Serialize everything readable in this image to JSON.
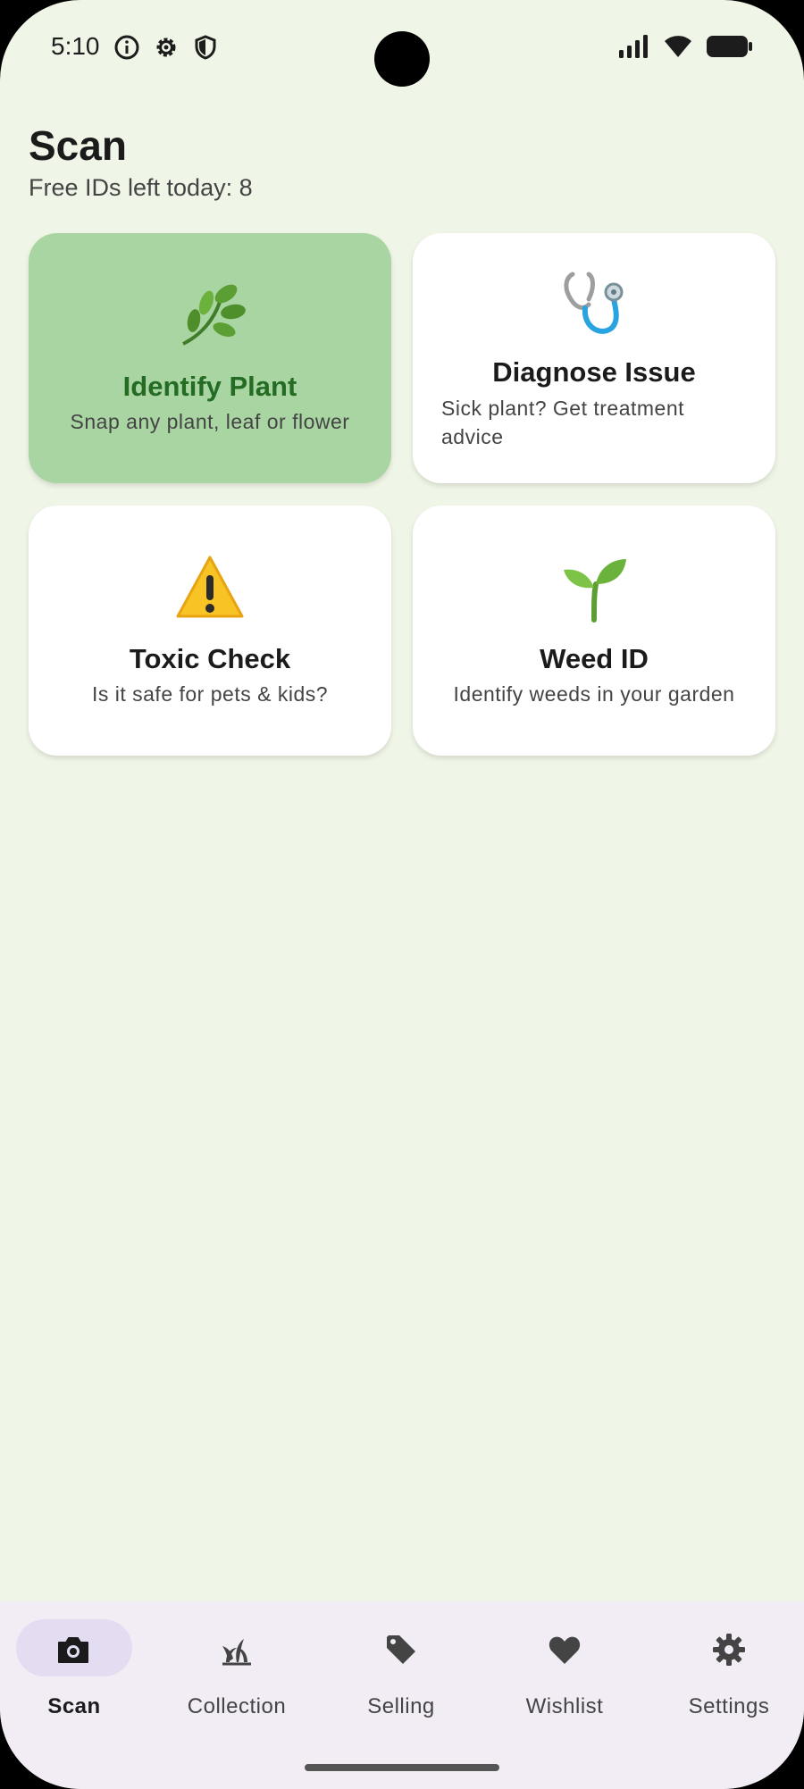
{
  "status_bar": {
    "time": "5:10"
  },
  "header": {
    "title": "Scan",
    "subtitle": "Free IDs left today: 8"
  },
  "cards": [
    {
      "title": "Identify Plant",
      "description": "Snap any plant, leaf or flower",
      "icon": "herb-icon",
      "active": true
    },
    {
      "title": "Diagnose Issue",
      "description": "Sick plant? Get treatment advice",
      "icon": "stethoscope-icon",
      "active": false
    },
    {
      "title": "Toxic Check",
      "description": "Is it safe for pets & kids?",
      "icon": "warning-icon",
      "active": false
    },
    {
      "title": "Weed ID",
      "description": "Identify weeds in your garden",
      "icon": "seedling-icon",
      "active": false
    }
  ],
  "bottom_nav": {
    "items": [
      {
        "label": "Scan",
        "icon": "camera-icon",
        "active": true
      },
      {
        "label": "Collection",
        "icon": "plant-collection-icon",
        "active": false
      },
      {
        "label": "Selling",
        "icon": "tag-icon",
        "active": false
      },
      {
        "label": "Wishlist",
        "icon": "heart-icon",
        "active": false
      },
      {
        "label": "Settings",
        "icon": "gear-icon",
        "active": false
      }
    ]
  },
  "colors": {
    "background": "#f0f6e7",
    "active_card": "#a8d5a2",
    "active_title": "#246b24",
    "nav_background": "#f2ecf5",
    "nav_active_pill": "#e4dcf1"
  }
}
